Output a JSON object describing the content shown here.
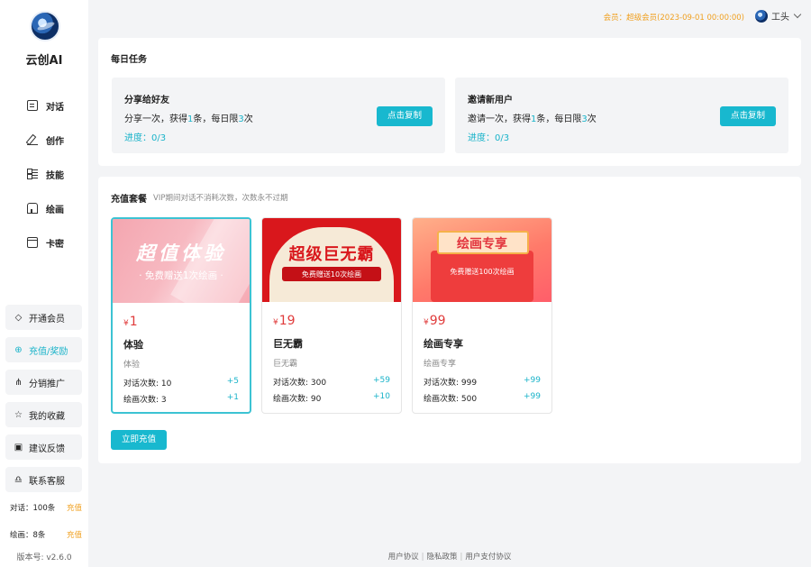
{
  "app": {
    "brand": "云创AI",
    "version": "版本号: v2.6.0"
  },
  "header": {
    "member_info": "会员：超级会员(2023-09-01 00:00:00)",
    "username": "工头"
  },
  "nav": {
    "items": [
      {
        "label": "对话",
        "icon": "chat-icon"
      },
      {
        "label": "创作",
        "icon": "pen-icon"
      },
      {
        "label": "技能",
        "icon": "skill-icon"
      },
      {
        "label": "绘画",
        "icon": "paint-icon"
      },
      {
        "label": "卡密",
        "icon": "card-icon"
      }
    ]
  },
  "side_buttons": [
    {
      "label": "开通会员",
      "icon": "diamond-icon"
    },
    {
      "label": "充值/奖励",
      "icon": "gift-icon"
    },
    {
      "label": "分销推广",
      "icon": "share-icon"
    },
    {
      "label": "我的收藏",
      "icon": "star-icon"
    },
    {
      "label": "建议反馈",
      "icon": "feedback-icon"
    },
    {
      "label": "联系客服",
      "icon": "headset-icon"
    }
  ],
  "quota": {
    "chat": "对话：100条",
    "draw": "绘画：8条",
    "charge_label": "充值"
  },
  "daily_tasks": {
    "title": "每日任务",
    "tasks": [
      {
        "name": "分享给好友",
        "desc_prefix": "分享一次，获得",
        "reward": "1",
        "desc_mid": "条，每日限",
        "limit": "3",
        "desc_suffix": "次",
        "progress": "进度：0/3",
        "button": "点击复制"
      },
      {
        "name": "邀请新用户",
        "desc_prefix": "邀请一次，获得",
        "reward": "1",
        "desc_mid": "条，每日限",
        "limit": "3",
        "desc_suffix": "次",
        "progress": "进度：0/3",
        "button": "点击复制"
      }
    ]
  },
  "recharge": {
    "title": "充值套餐",
    "subtitle": "VIP期间对话不消耗次数，次数永不过期",
    "buy_button": "立即充值",
    "plans": [
      {
        "banner_main": "超值体验",
        "banner_sub": "· 免费赠送1次绘画 ·",
        "currency": "¥",
        "price": "1",
        "name": "体验",
        "desc": "体验",
        "chat_label": "对话次数: 10",
        "chat_bonus": "+5",
        "draw_label": "绘画次数: 3",
        "draw_bonus": "+1"
      },
      {
        "banner_main": "超级巨无霸",
        "banner_sub": "免费赠送10次绘画",
        "currency": "¥",
        "price": "19",
        "name": "巨无霸",
        "desc": "巨无霸",
        "chat_label": "对话次数: 300",
        "chat_bonus": "+59",
        "draw_label": "绘画次数: 90",
        "draw_bonus": "+10"
      },
      {
        "banner_main": "绘画专享",
        "banner_sub": "免费赠送100次绘画",
        "currency": "¥",
        "price": "99",
        "name": "绘画专享",
        "desc": "绘画专享",
        "chat_label": "对话次数: 999",
        "chat_bonus": "+99",
        "draw_label": "绘画次数: 500",
        "draw_bonus": "+99"
      }
    ]
  },
  "footer": {
    "links": [
      "用户协议",
      "隐私政策",
      "用户支付协议"
    ],
    "separator": "|"
  },
  "colors": {
    "accent": "#18b8cf",
    "price": "#e03b3b",
    "member": "#f0a020"
  }
}
